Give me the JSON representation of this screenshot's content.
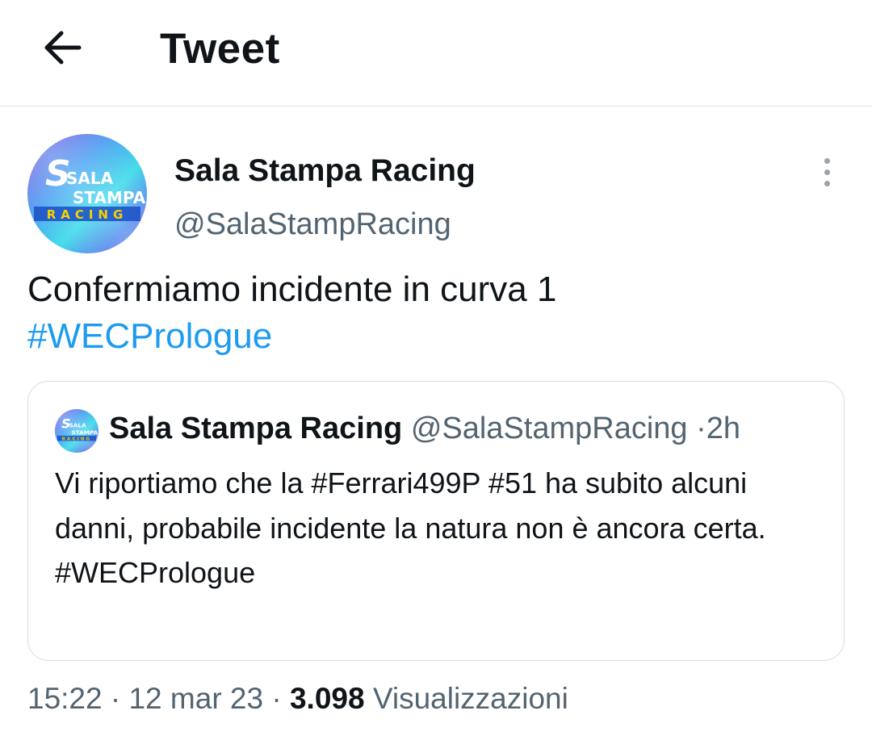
{
  "header": {
    "title": "Tweet",
    "back_icon": "arrow-left-icon"
  },
  "tweet": {
    "author_name": "Sala Stampa Racing",
    "author_handle": "@SalaStampRacing",
    "avatar_logo_text": [
      "SALA",
      "STAMPA",
      "RACING"
    ],
    "more_icon": "more-vertical-icon",
    "text": "Confermiamo incidente in curva 1",
    "hashtag": "#WECPrologue",
    "link_color": "#1d9bf0"
  },
  "quoted_tweet": {
    "author_name": "Sala Stampa Racing",
    "author_handle": "@SalaStampRacing",
    "separator": "·",
    "time": "2h",
    "text": "Vi riportiamo che la #Ferrari499P #51 ha subito alcuni danni, probabile incidente la natura non è ancora certa.",
    "hashtag": "#WECPrologue"
  },
  "meta": {
    "time": "15:22",
    "date": "12 mar 23",
    "separator": "·",
    "views_count": "3.098",
    "views_label": "Visualizzazioni"
  }
}
